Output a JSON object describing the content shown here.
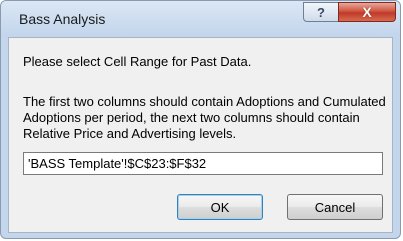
{
  "window": {
    "title": "Bass Analysis"
  },
  "titlebar": {
    "help_glyph": "?",
    "close_glyph": "X"
  },
  "dialog": {
    "prompt": "Please select Cell Range for Past Data.",
    "instructions": "The first two columns should contain Adoptions and Cumulated Adoptions per period, the next two columns should contain Relative Price and Advertising levels.",
    "range_value": "'BASS Template'!$C$23:$F$32"
  },
  "buttons": {
    "ok_label": "OK",
    "cancel_label": "Cancel"
  },
  "colors": {
    "close_button": "#c0392b",
    "default_button_border": "#3c7fb1"
  }
}
